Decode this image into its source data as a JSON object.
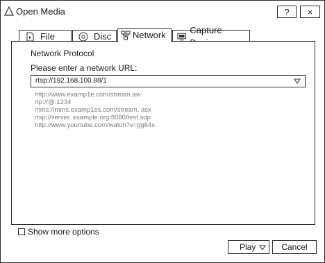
{
  "window": {
    "title": "Open Media",
    "help_label": "?",
    "close_label": "×",
    "title_icon": "triangle-icon"
  },
  "tabs": [
    {
      "label": "File",
      "icon": "file-icon"
    },
    {
      "label": "Disc",
      "icon": "disc-icon"
    },
    {
      "label": "Network",
      "icon": "network-icon",
      "selected": true
    },
    {
      "label": "Capture Device",
      "icon": "capture-device-icon"
    }
  ],
  "network": {
    "protocol_label": "Network Protocol",
    "enter_label": "Please enter a network URL:",
    "url_value": "rtsp://192.168.100.88/1",
    "examples": [
      "http://www.examp1e.com/stream.avi",
      "rtp://@:1234",
      "mms://mms.examp1es.com/stream. asx",
      "rtsp://server. example.org:8080/test.sdp",
      "http://www.yourtube.com/watch?v=gg64x"
    ]
  },
  "options": {
    "show_more_label": "Show more options",
    "show_more_checked": false
  },
  "buttons": {
    "play_label": "Play",
    "cancel_label": "Cancel"
  },
  "colors": {
    "border": "#2b2b2b",
    "example_text": "#7c7c7c"
  }
}
